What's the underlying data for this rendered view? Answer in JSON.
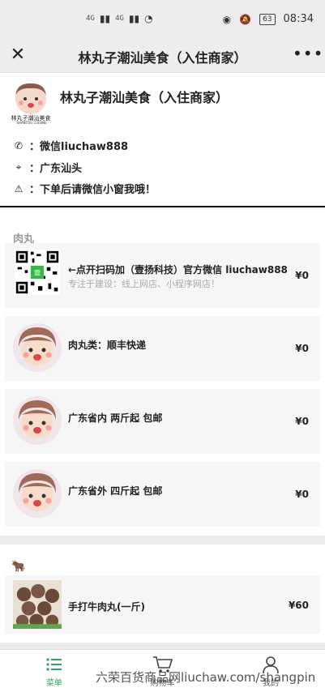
{
  "status": {
    "signal1": "4G",
    "signal2": "4G",
    "battery": "63",
    "time": "08:34"
  },
  "titlebar": {
    "title": "林丸子潮汕美食（入住商家）"
  },
  "shop": {
    "name": "林丸子潮汕美食（入住商家）",
    "logo_text": "SHANTOU CUISINE",
    "phone": "：微信liuchaw888",
    "address": "：广东汕头",
    "notice": "：下单后请微信小窗我哦！"
  },
  "menu": {
    "categories": [
      {
        "title": "肉丸",
        "items": [
          {
            "name": "←点开扫码加（壹扬科技）官方微信 liuchaw888",
            "desc": "专注于建设：线上网店、小程序网店！",
            "price": "¥0"
          },
          {
            "name": "肉丸类：顺丰快递",
            "price": "¥0"
          },
          {
            "name": "广东省内 两斤起 包邮",
            "price": "¥0"
          },
          {
            "name": "广东省外 四斤起 包邮",
            "price": "¥0"
          }
        ]
      },
      {
        "title_icon": "cow-icon",
        "items": [
          {
            "name": "手打牛肉丸(一斤)",
            "price": "¥60"
          }
        ]
      }
    ]
  },
  "tabbar": {
    "menu": "菜单",
    "cart": "购物车",
    "mine": "我的"
  },
  "watermark": "六荣百货商品网liuchaw.com/shangpin",
  "colors": {
    "accent": "#2fa360"
  }
}
